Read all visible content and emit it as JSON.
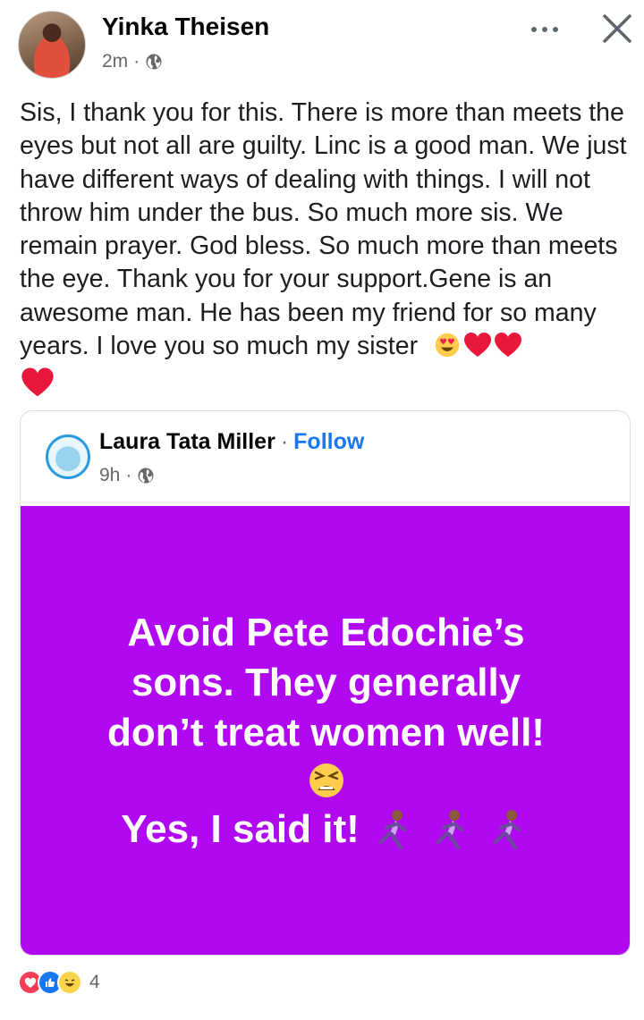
{
  "post": {
    "author": "Yinka Theisen",
    "time": "2m",
    "separator": "·",
    "privacy_icon": "globe-icon",
    "text": "Sis, I thank you for this. There is more than meets the eyes but not all are guilty. Linc is a good man. We just have different ways of dealing with things. I will not throw him under the bus. So much more sis. We remain prayer. God bless. So much more than meets the eye. Thank you for your support.Gene is an awesome man. He has been my friend for so many years. I love you so much my sister",
    "trailing_emoji": [
      "heart-eyes-emoji",
      "red-heart-emoji",
      "red-heart-emoji",
      "red-heart-emoji"
    ]
  },
  "shared": {
    "author": "Laura Tata Miller",
    "separator": "·",
    "follow_label": "Follow",
    "time": "9h",
    "banner_color": "#b108f2",
    "banner_line1": "Avoid Pete Edochie’s",
    "banner_line2": "sons. They generally",
    "banner_line3": "don’t treat women well!",
    "banner_emoji": "tired-face-emoji",
    "banner_line4": "Yes, I said it!",
    "runner_emoji": "woman-running-emoji"
  },
  "reactions": {
    "types": [
      "love-reaction-icon",
      "like-reaction-icon",
      "haha-reaction-icon"
    ],
    "count": "4"
  },
  "colors": {
    "link": "#1877f2",
    "meta": "#65676b",
    "heart": "#f02849"
  }
}
